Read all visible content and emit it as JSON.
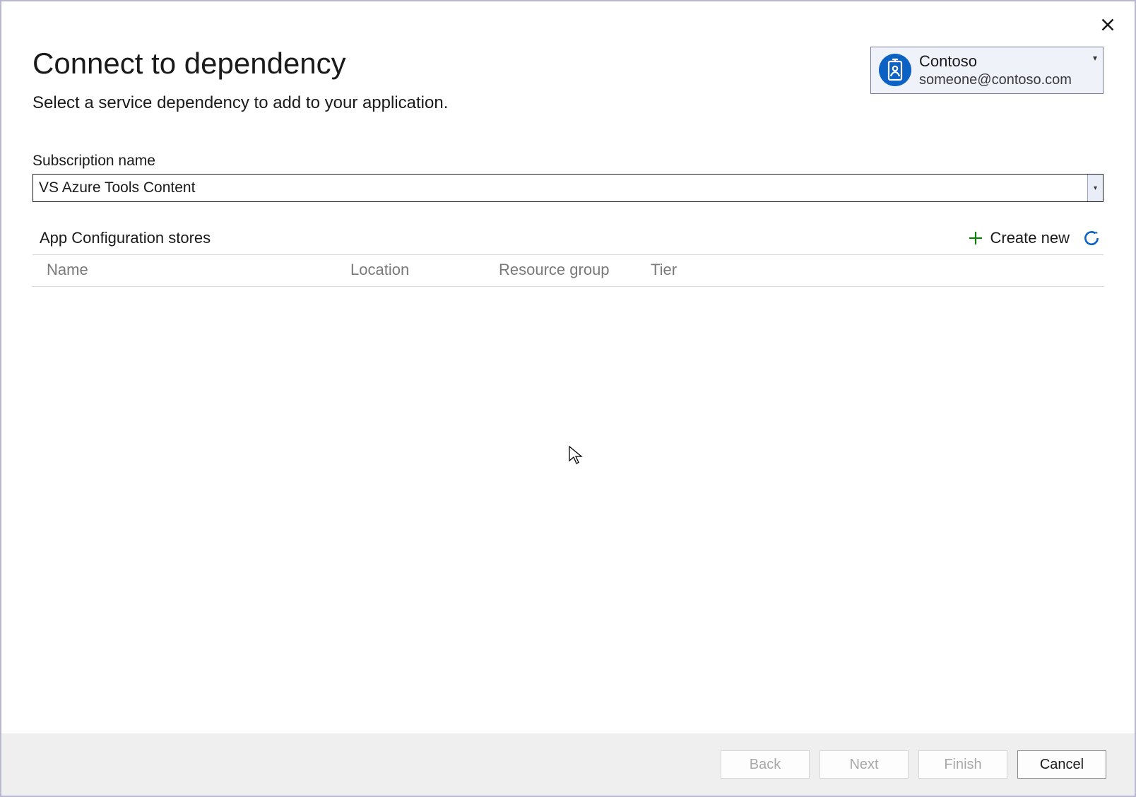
{
  "dialog": {
    "title": "Connect to dependency",
    "subtitle": "Select a service dependency to add to your application."
  },
  "account": {
    "name": "Contoso",
    "email": "someone@contoso.com"
  },
  "subscription": {
    "label": "Subscription name",
    "value": "VS Azure Tools Content"
  },
  "stores": {
    "label": "App Configuration stores",
    "create_new": "Create new",
    "columns": {
      "name": "Name",
      "location": "Location",
      "resource_group": "Resource group",
      "tier": "Tier"
    }
  },
  "footer": {
    "back": "Back",
    "next": "Next",
    "finish": "Finish",
    "cancel": "Cancel"
  }
}
